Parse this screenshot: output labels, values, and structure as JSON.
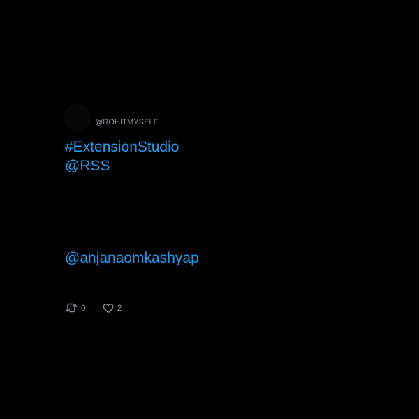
{
  "tweet": {
    "author_handle": "@ROHITMYSELF",
    "lines": {
      "hashtag": "#ExtensionStudio",
      "mention_rss": "@RSS",
      "mention_user": "@anjanaomkashyap"
    },
    "retweet_count": "0",
    "like_count": "2"
  },
  "icons": {
    "retweet": "retweet-icon",
    "like": "heart-icon"
  },
  "colors": {
    "background": "#000000",
    "link": "#1d9bf0",
    "muted": "#8a8f96"
  }
}
